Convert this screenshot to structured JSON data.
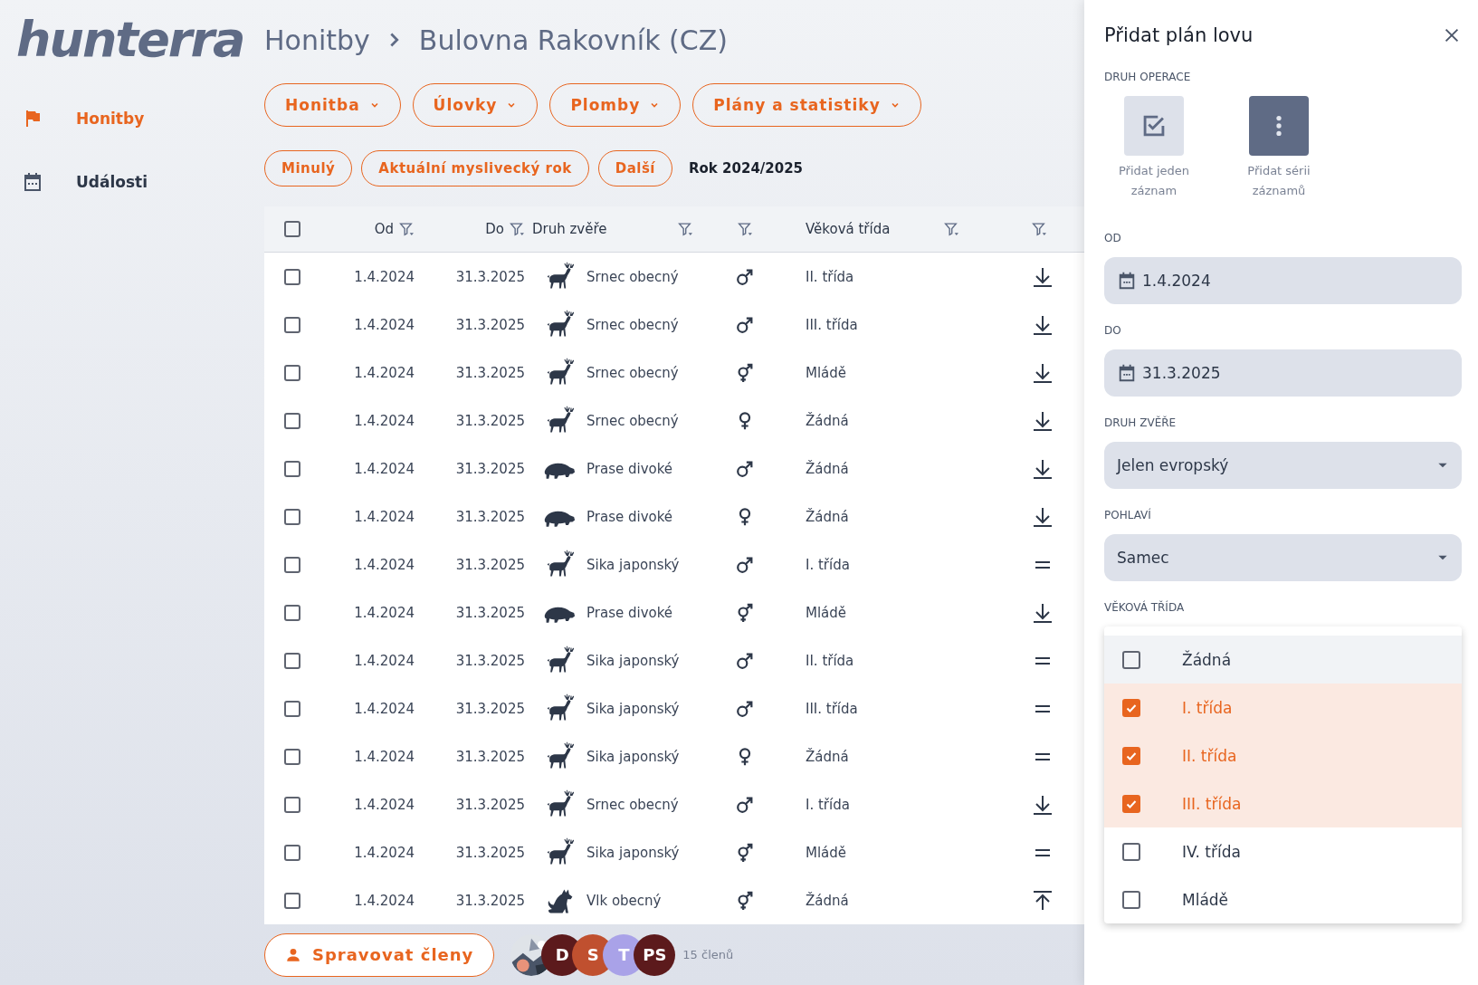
{
  "logo": "hunterra",
  "breadcrumb": [
    "Honitby",
    "Bulovna Rakovník (CZ)"
  ],
  "sidebar": {
    "items": [
      {
        "label": "Honitby",
        "selected": true
      },
      {
        "label": "Události",
        "selected": false
      }
    ]
  },
  "menu_buttons": [
    "Honitba",
    "Úlovky",
    "Plomby",
    "Plány a statistiky"
  ],
  "year_buttons": [
    "Minulý",
    "Aktuální myslivecký rok",
    "Další"
  ],
  "year_label": "Rok 2024/2025",
  "table": {
    "columns": [
      {
        "label": "Od",
        "filter": true
      },
      {
        "label": "Do",
        "filter": true
      },
      {
        "label": "Druh zvěře",
        "filter": true
      },
      {
        "filter": true
      },
      {
        "label": "Věková třída",
        "filter": true
      },
      {
        "filter": true
      }
    ],
    "header_checked": false,
    "rows": [
      {
        "checked": false,
        "from": "1.4.2024",
        "to": "31.3.2025",
        "species": {
          "kind": "deer",
          "name": "Srnec obecný"
        },
        "sex": {
          "kind": "male"
        },
        "age_class": "II. třída",
        "trend": {
          "kind": "down"
        }
      },
      {
        "checked": false,
        "from": "1.4.2024",
        "to": "31.3.2025",
        "species": {
          "kind": "deer",
          "name": "Srnec obecný"
        },
        "sex": {
          "kind": "male"
        },
        "age_class": "III. třída",
        "trend": {
          "kind": "down"
        }
      },
      {
        "checked": false,
        "from": "1.4.2024",
        "to": "31.3.2025",
        "species": {
          "kind": "deer",
          "name": "Srnec obecný"
        },
        "sex": {
          "kind": "both"
        },
        "age_class": "Mládě",
        "trend": {
          "kind": "down"
        }
      },
      {
        "checked": false,
        "from": "1.4.2024",
        "to": "31.3.2025",
        "species": {
          "kind": "deer",
          "name": "Srnec obecný"
        },
        "sex": {
          "kind": "female"
        },
        "age_class": "Žádná",
        "trend": {
          "kind": "down"
        }
      },
      {
        "checked": false,
        "from": "1.4.2024",
        "to": "31.3.2025",
        "species": {
          "kind": "boar",
          "name": "Prase divoké"
        },
        "sex": {
          "kind": "male"
        },
        "age_class": "Žádná",
        "trend": {
          "kind": "down"
        }
      },
      {
        "checked": false,
        "from": "1.4.2024",
        "to": "31.3.2025",
        "species": {
          "kind": "boar",
          "name": "Prase divoké"
        },
        "sex": {
          "kind": "female"
        },
        "age_class": "Žádná",
        "trend": {
          "kind": "down"
        }
      },
      {
        "checked": false,
        "from": "1.4.2024",
        "to": "31.3.2025",
        "species": {
          "kind": "deer",
          "name": "Sika japonský"
        },
        "sex": {
          "kind": "male"
        },
        "age_class": "I. třída",
        "trend": {
          "kind": "equal"
        }
      },
      {
        "checked": false,
        "from": "1.4.2024",
        "to": "31.3.2025",
        "species": {
          "kind": "boar",
          "name": "Prase divoké"
        },
        "sex": {
          "kind": "both"
        },
        "age_class": "Mládě",
        "trend": {
          "kind": "down"
        }
      },
      {
        "checked": false,
        "from": "1.4.2024",
        "to": "31.3.2025",
        "species": {
          "kind": "deer",
          "name": "Sika japonský"
        },
        "sex": {
          "kind": "male"
        },
        "age_class": "II. třída",
        "trend": {
          "kind": "equal"
        }
      },
      {
        "checked": false,
        "from": "1.4.2024",
        "to": "31.3.2025",
        "species": {
          "kind": "deer",
          "name": "Sika japonský"
        },
        "sex": {
          "kind": "male"
        },
        "age_class": "III. třída",
        "trend": {
          "kind": "equal"
        }
      },
      {
        "checked": false,
        "from": "1.4.2024",
        "to": "31.3.2025",
        "species": {
          "kind": "deer",
          "name": "Sika japonský"
        },
        "sex": {
          "kind": "female"
        },
        "age_class": "Žádná",
        "trend": {
          "kind": "equal"
        }
      },
      {
        "checked": false,
        "from": "1.4.2024",
        "to": "31.3.2025",
        "species": {
          "kind": "deer",
          "name": "Srnec obecný"
        },
        "sex": {
          "kind": "male"
        },
        "age_class": "I. třída",
        "trend": {
          "kind": "down"
        }
      },
      {
        "checked": false,
        "from": "1.4.2024",
        "to": "31.3.2025",
        "species": {
          "kind": "deer",
          "name": "Sika japonský"
        },
        "sex": {
          "kind": "both"
        },
        "age_class": "Mládě",
        "trend": {
          "kind": "equal"
        }
      },
      {
        "checked": false,
        "from": "1.4.2024",
        "to": "31.3.2025",
        "species": {
          "kind": "wolf",
          "name": "Vlk obecný"
        },
        "sex": {
          "kind": "both"
        },
        "age_class": "Žádná",
        "trend": {
          "kind": "up"
        }
      }
    ]
  },
  "members": {
    "button": "Spravovat členy",
    "avatars": [
      {
        "kind": "picture"
      },
      {
        "kind": "initials",
        "initials": "D",
        "color": "#5c1a1c"
      },
      {
        "kind": "initials",
        "initials": "S",
        "color": "#c0502f"
      },
      {
        "kind": "initials",
        "initials": "T",
        "color": "#a9a2e8"
      },
      {
        "kind": "initials",
        "initials": "PS",
        "color": "#5c1a1c"
      }
    ],
    "count": "15 členů"
  },
  "panel": {
    "title": "Přidat plán lovu",
    "operation_label": "DRUH OPERACE",
    "operations": [
      {
        "label": "Přidat jeden záznam",
        "selected": false
      },
      {
        "label": "Přidat sérii záznamů",
        "selected": true
      }
    ],
    "from_label": "OD",
    "from_value": "1.4.2024",
    "to_label": "DO",
    "to_value": "31.3.2025",
    "species_label": "DRUH ZVĚŘE",
    "species_value": "Jelen evropský",
    "sex_label": "POHLAVÍ",
    "sex_value": "Samec",
    "age_label": "VĚKOVÁ TŘÍDA",
    "age_options": [
      {
        "label": "Žádná",
        "checked": false,
        "hovered": true
      },
      {
        "label": "I. třída",
        "checked": true,
        "hovered": false
      },
      {
        "label": "II. třída",
        "checked": true,
        "hovered": false
      },
      {
        "label": "III. třída",
        "checked": true,
        "hovered": false
      },
      {
        "label": "IV. třída",
        "checked": false,
        "hovered": false
      },
      {
        "label": "Mládě",
        "checked": false,
        "hovered": false
      }
    ]
  }
}
